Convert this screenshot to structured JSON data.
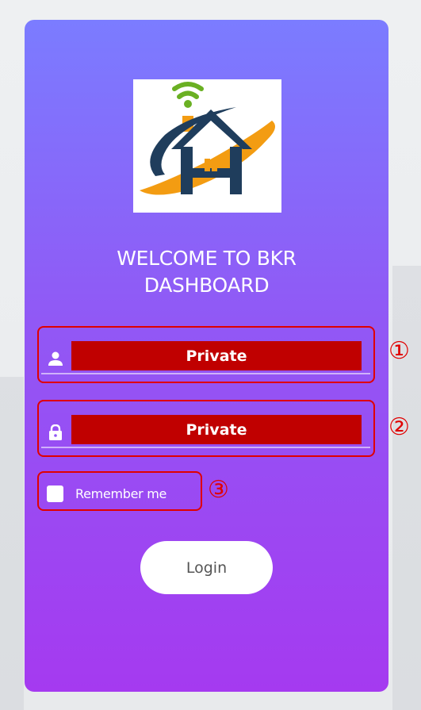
{
  "login": {
    "welcome_line1": "WELCOME TO BKR",
    "welcome_line2": "DASHBOARD",
    "username_value": "Private",
    "password_value": "Private",
    "remember_label": "Remember me",
    "login_label": "Login"
  },
  "icons": {
    "username": "user-icon",
    "password": "lock-icon",
    "logo": "house-wifi-logo"
  },
  "annotations": {
    "labels": [
      "①",
      "②",
      "③"
    ]
  },
  "colors": {
    "card_top": "#7b7cff",
    "card_bottom": "#a53af0",
    "redaction": "#c00000",
    "annotation": "#e00000",
    "logo_navy": "#1f3d5c",
    "logo_orange": "#f39c12",
    "logo_green": "#6ab023"
  }
}
